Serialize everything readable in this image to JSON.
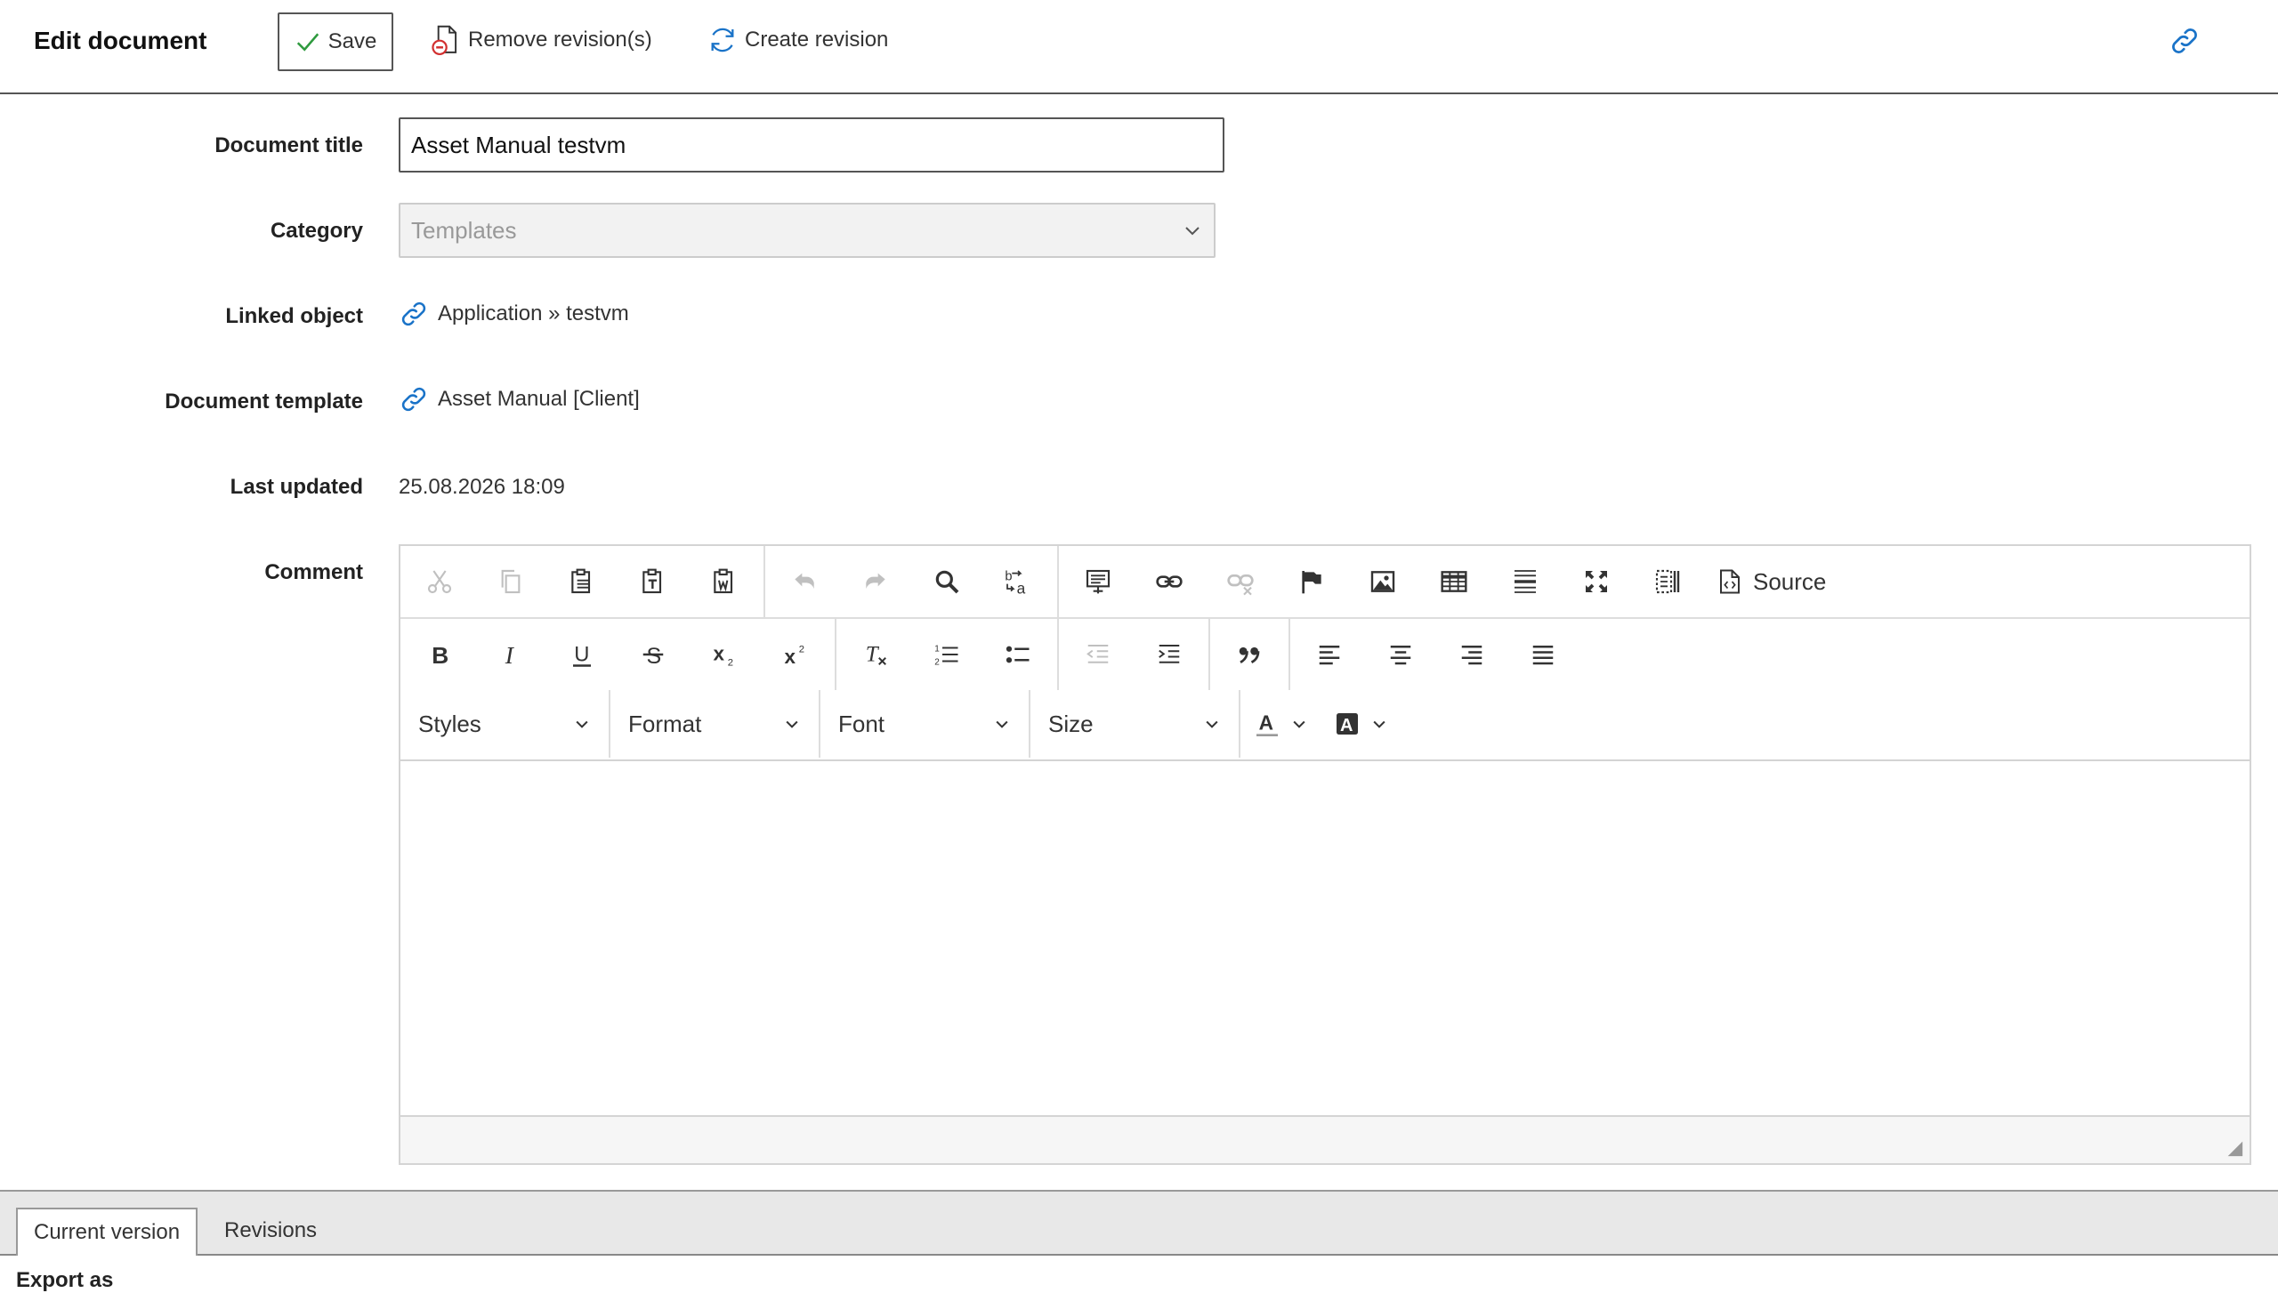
{
  "header": {
    "title": "Edit document",
    "save_label": "Save",
    "remove_label": "Remove revision(s)",
    "create_label": "Create revision"
  },
  "form": {
    "title_label": "Document title",
    "title_value": "Asset Manual testvm",
    "category_label": "Category",
    "category_value": "Templates",
    "linked_label": "Linked object",
    "linked_value": "Application » testvm",
    "template_label": "Document template",
    "template_value": "Asset Manual [Client]",
    "updated_label": "Last updated",
    "updated_value": "25.08.2026 18:09",
    "comment_label": "Comment"
  },
  "editor": {
    "source_label": "Source",
    "styles_label": "Styles",
    "format_label": "Format",
    "font_label": "Font",
    "size_label": "Size"
  },
  "tabs": {
    "current": "Current version",
    "revisions": "Revisions"
  },
  "footer": {
    "export_label": "Export as"
  },
  "colors": {
    "accent_link": "#1a73c8",
    "save_check": "#2e9a3e",
    "remove_red": "#d23030",
    "border_dark": "#555555"
  }
}
